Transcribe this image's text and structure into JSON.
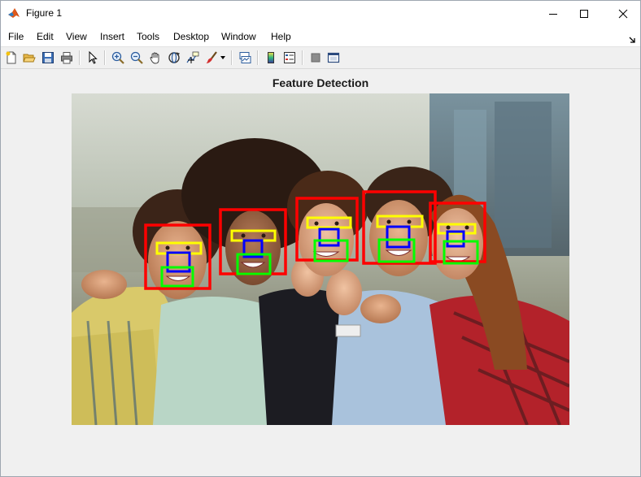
{
  "window": {
    "title": "Figure 1",
    "accent": "#0078d7"
  },
  "menu": {
    "items": [
      "File",
      "Edit",
      "View",
      "Insert",
      "Tools",
      "Desktop",
      "Window",
      "Help"
    ]
  },
  "toolbar": {
    "buttons": [
      "new-figure-icon",
      "open-file-icon",
      "save-icon",
      "print-icon",
      "edit-plot-arrow-icon",
      "zoom-in-icon",
      "zoom-out-icon",
      "pan-hand-icon",
      "rotate-3d-icon",
      "data-cursor-icon",
      "brush-icon",
      "brush-dropdown-icon",
      "link-plot-icon",
      "insert-colorbar-icon",
      "insert-legend-icon",
      "hide-plot-tools-icon",
      "show-plot-tools-icon"
    ]
  },
  "plot": {
    "title": "Feature Detection",
    "image_subject": "photo of five smiling friends with detection boxes",
    "box_colors": {
      "face": "#ff0000",
      "eyes": "#ffff00",
      "nose": "#0000ff",
      "mouth": "#00ff00"
    }
  }
}
